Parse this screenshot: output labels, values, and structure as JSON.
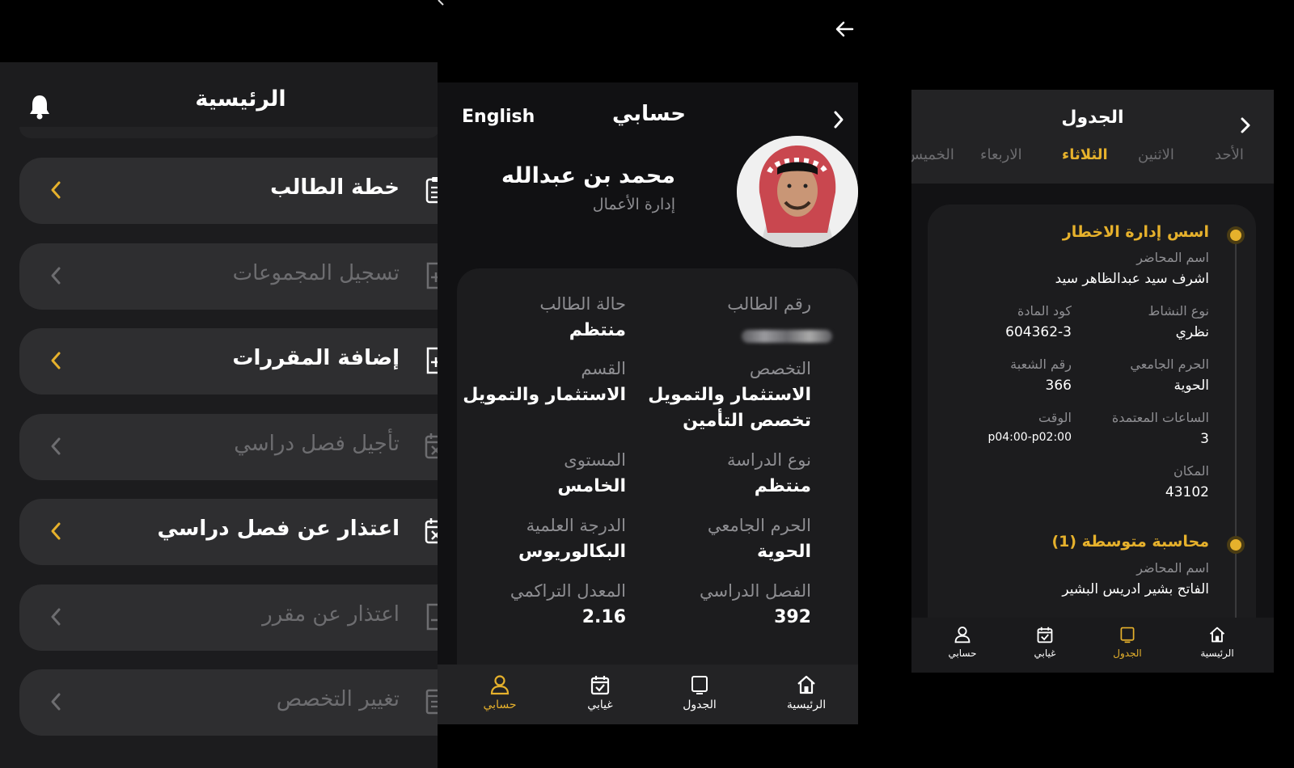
{
  "home": {
    "title": "الرئيسية",
    "menu": [
      {
        "label": "خطة الطالب",
        "icon": "clipboard-icon",
        "enabled": true
      },
      {
        "label": "تسجيل المجموعات",
        "icon": "file-plus-icon",
        "enabled": false
      },
      {
        "label": "إضافة المقررات",
        "icon": "file-plus-icon",
        "enabled": true
      },
      {
        "label": "تأجيل فصل دراسي",
        "icon": "calendar-x-icon",
        "enabled": false
      },
      {
        "label": "اعتذار عن فصل دراسي",
        "icon": "calendar-x-icon",
        "enabled": true
      },
      {
        "label": "اعتذار عن مقرر",
        "icon": "file-minus-icon",
        "enabled": false
      },
      {
        "label": "تغيير التخصص",
        "icon": "document-icon",
        "enabled": false
      }
    ]
  },
  "profile": {
    "title": "حسابي",
    "language_toggle": "English",
    "name": "محمد بن عبدالله",
    "department": "إدارة الأعمال",
    "fields": {
      "student_id_label": "رقم الطالب",
      "status_label": "حالة الطالب",
      "status_value": "منتظم",
      "major_label": "التخصص",
      "major_value_1": "الاستثمار والتمويل",
      "major_value_2": "تخصص التأمين",
      "section_label": "القسم",
      "section_value": "الاستثمار والتمويل",
      "study_type_label": "نوع الدراسة",
      "study_type_value": "منتظم",
      "level_label": "المستوى",
      "level_value": "الخامس",
      "campus_label": "الحرم الجامعي",
      "campus_value": "الحوية",
      "degree_label": "الدرجة العلمية",
      "degree_value": "البكالوريوس",
      "semester_label": "الفصل الدراسي",
      "semester_value": "392",
      "gpa_label": "المعدل التراكمي",
      "gpa_value": "2.16"
    }
  },
  "schedule": {
    "title": "الجدول",
    "days": [
      "الأحد",
      "الاثنين",
      "الثلاثاء",
      "الاربعاء",
      "الخميس"
    ],
    "active_day": "الثلاثاء",
    "courses": [
      {
        "name": "اسس إدارة الاخطار",
        "instructor_label": "اسم المحاضر",
        "instructor": "اشرف سيد عبدالظاهر سيد",
        "activity_label": "نوع النشاط",
        "activity": "نظري",
        "code_label": "كود المادة",
        "code": "604362-3",
        "campus_label": "الحرم الجامعي",
        "campus": "الحوية",
        "section_label": "رقم الشعبة",
        "section": "366",
        "hours_label": "الساعات المعتمدة",
        "hours": "3",
        "time_label": "الوقت",
        "time": "p04:00-p02:00",
        "place_label": "المكان",
        "place": "43102"
      },
      {
        "name": "محاسبة متوسطة (1)",
        "instructor_label": "اسم المحاضر",
        "instructor": "الفاتح بشير ادريس البشير"
      }
    ]
  },
  "nav": {
    "home": "الرئيسية",
    "schedule": "الجدول",
    "absence": "غيابي",
    "account": "حسابي"
  },
  "colors": {
    "accent": "#e6b12c",
    "panel": "#1c1c1e",
    "card": "#2e2e30",
    "muted": "#8e8e92"
  }
}
